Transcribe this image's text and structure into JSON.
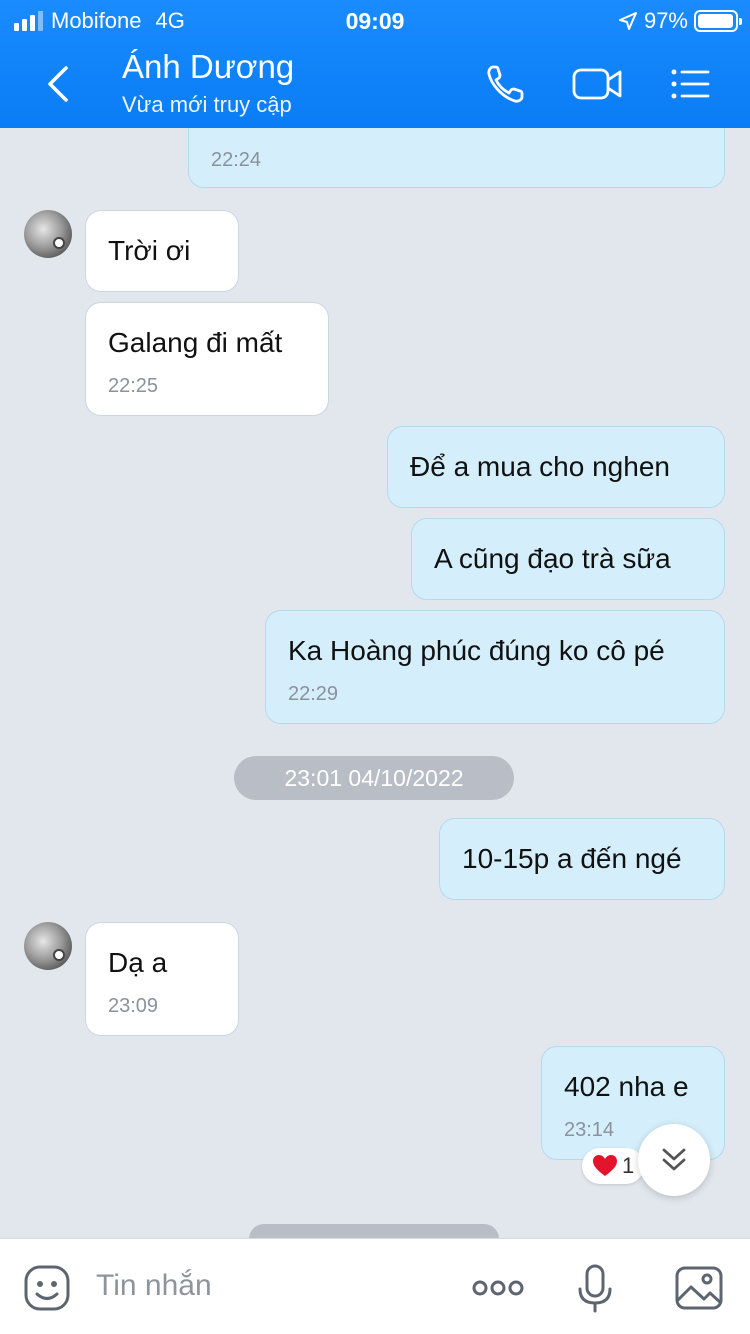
{
  "status": {
    "carrier": "Mobifone",
    "network": "4G",
    "time": "09:09",
    "battery": "97%",
    "battery_level": 0.97
  },
  "header": {
    "contact_name": "Ánh Dương",
    "presence": "Vừa mới truy cập",
    "icons": [
      "back-icon",
      "phone-icon",
      "video-call-icon",
      "menu-icon"
    ]
  },
  "messages": [
    {
      "side": "out",
      "text": "",
      "time": "22:24"
    },
    {
      "side": "in",
      "text": "Trời ơi",
      "time": ""
    },
    {
      "side": "in",
      "text": "Galang đi mất",
      "time": "22:25"
    },
    {
      "side": "out",
      "text": "Để a mua cho nghen",
      "time": ""
    },
    {
      "side": "out",
      "text": "A cũng đạo trà sữa",
      "time": ""
    },
    {
      "side": "out",
      "text": "Ka Hoàng phúc đúng ko cô pé",
      "time": "22:29"
    },
    {
      "side": "out",
      "text": "10-15p a đến ngé",
      "time": ""
    },
    {
      "side": "in",
      "text": "Dạ a",
      "time": "23:09"
    },
    {
      "side": "out",
      "text": "402 nha e",
      "time": "23:14"
    }
  ],
  "date_separator": "23:01 04/10/2022",
  "reaction": {
    "icon": "heart-icon",
    "count": "1"
  },
  "input": {
    "placeholder": "Tin nhắn",
    "icons": [
      "sticker-icon",
      "more-icon",
      "microphone-icon",
      "image-icon"
    ]
  },
  "colors": {
    "header": "#0a7cf5",
    "background": "#e2e7ee",
    "outgoing_bubble": "#d4eefb",
    "incoming_bubble": "#ffffff"
  }
}
